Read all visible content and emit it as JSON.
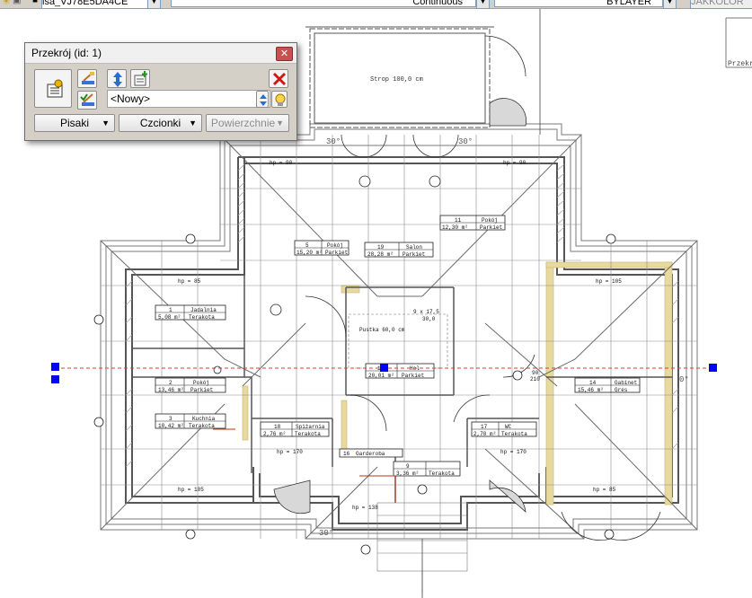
{
  "toolbar": {
    "layer_field": "isa_VJ78E5DA4CE",
    "linetype_field": "Continuous",
    "layer2_field": "BYLAYER",
    "layer3_field": "JAKKOLOR"
  },
  "drawing": {
    "plan_label": "Przekr",
    "labels": {
      "strop": "Strop 100,0 cm",
      "hp1": "hp = 90",
      "hp2": "hp = 90",
      "hp_left": "hp = 85",
      "hp_right": "hp = 105",
      "hp_bl": "hp = 105",
      "hp_br": "hp = 85",
      "hp_mid1": "hp = 170",
      "hp_mid2": "hp = 170",
      "hp_bottom": "hp = 138",
      "room_1_num": "1",
      "room_1_name": "Jadalnia",
      "room_1_area": "5,08 m²",
      "room_1_floor": "Terakota",
      "room_2_num": "2",
      "room_2_name": "Pokój",
      "room_2_area": "13,46 m²",
      "room_2_floor": "Parkiet",
      "room_3_num": "3",
      "room_3_name": "Kuchnia",
      "room_3_area": "10,42 m²",
      "room_3_floor": "Terakota",
      "room_5_num": "5",
      "room_5_name": "Pokój",
      "room_5_area": "15,20 m²",
      "room_5_floor": "Parkiet",
      "room_19_num": "19",
      "room_19_name": "Salon",
      "room_19_area": "28,28 m²",
      "room_19_floor": "Parkiet",
      "room_11_num": "11",
      "room_11_name": "Pokój",
      "room_11_area": "12,30 m²",
      "room_11_floor": "Parkiet",
      "room_hol_num": "13",
      "room_hol_name": "Hol",
      "room_hol_area": "20,01 m²",
      "room_hol_floor": "Parkiet",
      "room_14_num": "14",
      "room_14_name": "Gabinet",
      "room_14_area": "15,46 m²",
      "room_14_floor": "Gres",
      "room_18_num": "18",
      "room_18_name": "Spiżarnia",
      "room_18_area": "2,76 m²",
      "room_18_floor": "Terakota",
      "room_17_num": "17",
      "room_17_name": "WC",
      "room_17_area": "2,70 m²",
      "room_17_floor": "Terakota",
      "room_16_num": "16",
      "room_16_name": "Garderoba",
      "room_9_num": "9",
      "room_9_area": "3,36 m²",
      "room_9_floor": "Terakota",
      "stairs": "9 x 17,5",
      "stairs2": "30,0",
      "void": "Pustka 60,0 cm",
      "angle_tl": "30°",
      "angle_tr": "30°",
      "angle_b": "30°",
      "angle_r": "0°",
      "d13": "90",
      "d14": "210"
    }
  },
  "panel": {
    "title": "Przekrój (id: 1)",
    "name_value": "<Nowy>",
    "pens_label": "Pisaki",
    "fonts_label": "Czcionki",
    "surfaces_label": "Powierzchnie"
  },
  "colors": {
    "wall": "#6a6a6a",
    "section_line": "#e03a3a",
    "grip": "#0000ff",
    "insulation": "#e8d9a0",
    "panel_bg": "#d4d0c8"
  }
}
